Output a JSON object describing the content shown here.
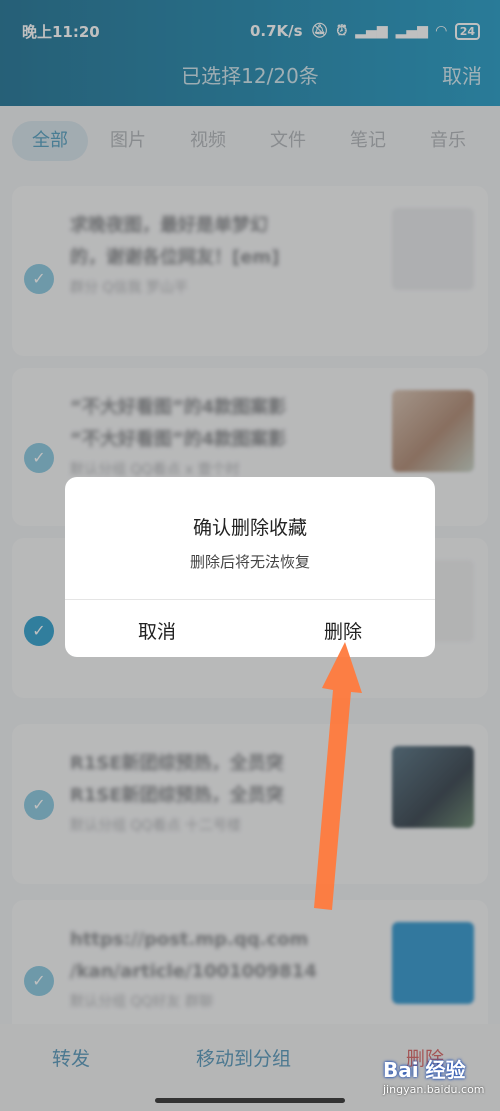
{
  "status_bar": {
    "time": "晚上11:20",
    "network_speed": "0.7K/s",
    "battery": "24",
    "icons": [
      "mute-icon",
      "alarm-icon",
      "signal-icon",
      "signal-icon",
      "wifi-icon",
      "battery-icon"
    ]
  },
  "header": {
    "title": "已选择12/20条",
    "cancel_label": "取消"
  },
  "tabs": [
    {
      "label": "全部",
      "active": true
    },
    {
      "label": "图片",
      "active": false
    },
    {
      "label": "视频",
      "active": false
    },
    {
      "label": "文件",
      "active": false
    },
    {
      "label": "笔记",
      "active": false
    },
    {
      "label": "音乐",
      "active": false
    }
  ],
  "items": [
    {
      "line1": "求晚夜图，最好是单梦幻",
      "line2": "的，谢谢各位网友！[em]",
      "meta1": "群分 Q信我 罗山平",
      "meta2": "",
      "checked": true
    },
    {
      "line1": "“不大好看图”的4款图案影",
      "line2": "“不大好看图”的4款图案影",
      "meta1": "默认分组 QQ看点 x 壹个时",
      "meta2": "",
      "checked": true
    },
    {
      "line1": "",
      "line2": "",
      "meta1": "",
      "meta2": "",
      "checked": true
    },
    {
      "line1": "R1SE新团综预热，全员突",
      "line2": "R1SE新团综预热，全员突",
      "meta1": "默认分组 QQ看点 十二号楼",
      "meta2": "",
      "checked": true
    },
    {
      "line1": "https://post.mp.qq.com",
      "line2": "/kan/article/1001009814",
      "meta1": "默认分组 QQ好友 群聊",
      "meta2": "",
      "checked": true
    }
  ],
  "dialog": {
    "title": "确认删除收藏",
    "message": "删除后将无法恢复",
    "cancel_label": "取消",
    "delete_label": "删除"
  },
  "bottom_bar": {
    "forward_label": "转发",
    "move_label": "移动到分组",
    "delete_label": "删除"
  },
  "watermark": {
    "logo": "Bai 经验",
    "url": "jingyan.baidu.com"
  },
  "colors": {
    "header_start": "#2a7a9a",
    "header_end": "#2ea0c8",
    "accent": "#3aa4cf",
    "delete_red": "#d86b6b",
    "arrow": "#ff7a3d"
  }
}
